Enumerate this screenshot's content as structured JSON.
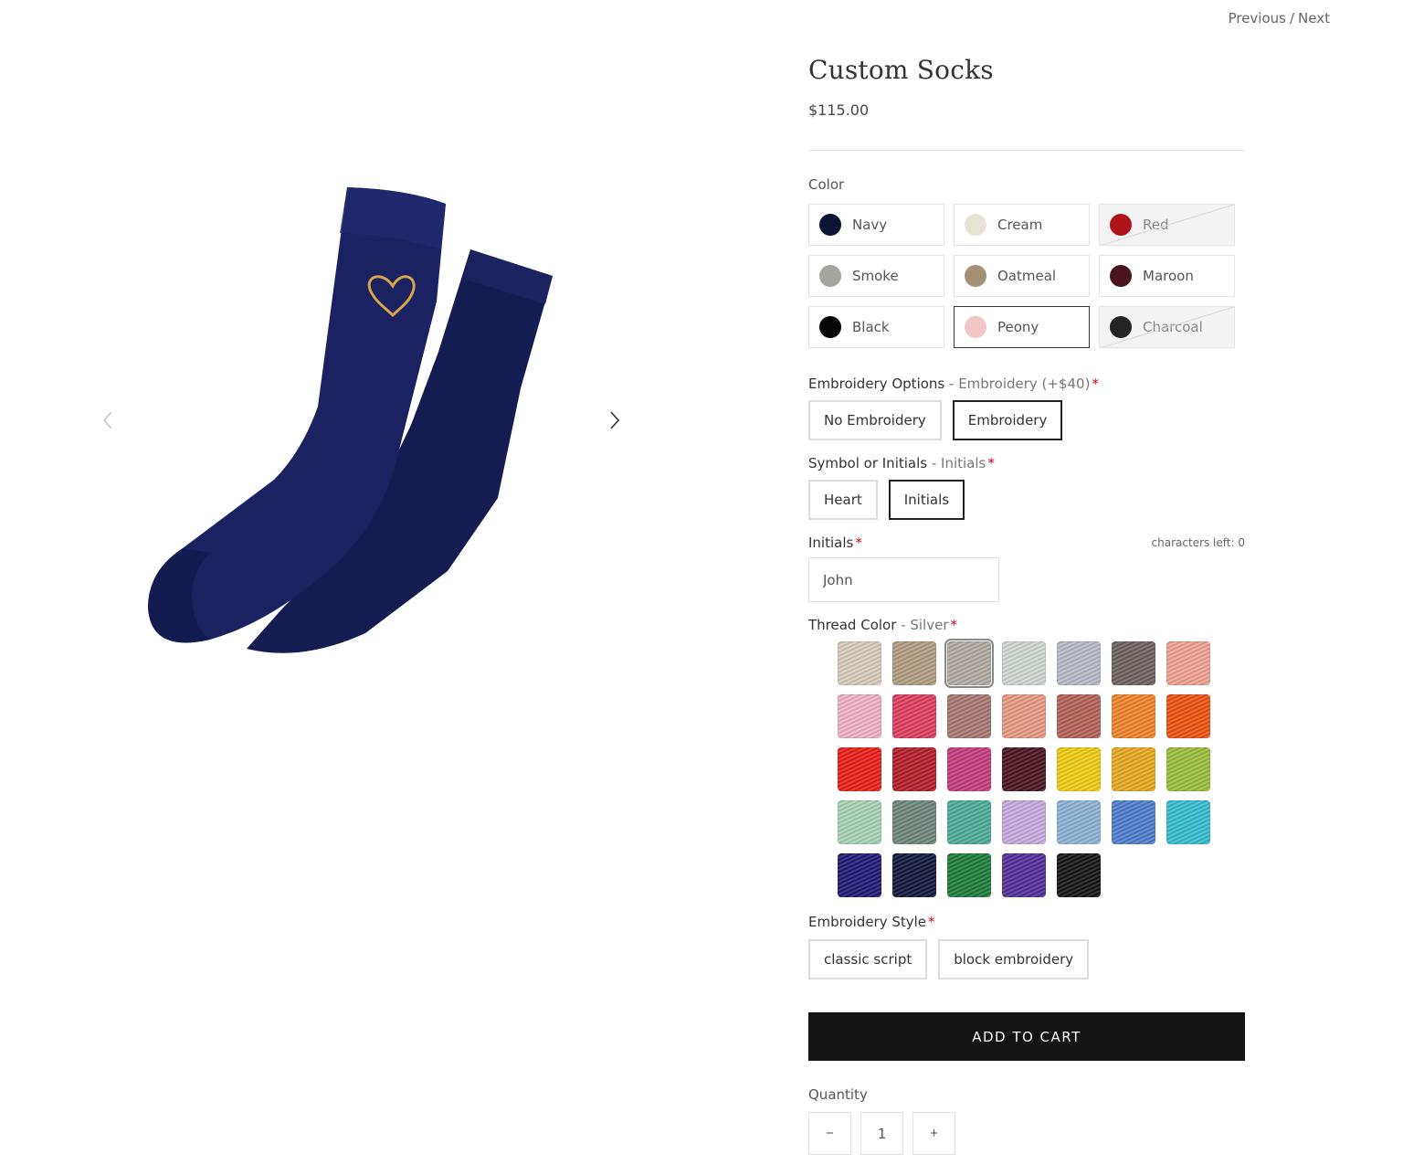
{
  "pager": {
    "previous": "Previous",
    "separator": "/",
    "next": "Next"
  },
  "product": {
    "title": "Custom Socks",
    "price": "$115.00"
  },
  "color": {
    "label": "Color",
    "options": [
      {
        "name": "Navy",
        "hex": "#0c1333",
        "state": "available"
      },
      {
        "name": "Cream",
        "hex": "#e8e3d3",
        "state": "available"
      },
      {
        "name": "Red",
        "hex": "#b0141b",
        "state": "soldout"
      },
      {
        "name": "Smoke",
        "hex": "#a6a49f",
        "state": "available"
      },
      {
        "name": "Oatmeal",
        "hex": "#a48f77",
        "state": "available"
      },
      {
        "name": "Maroon",
        "hex": "#4a141f",
        "state": "available"
      },
      {
        "name": "Black",
        "hex": "#070707",
        "state": "available"
      },
      {
        "name": "Peony",
        "hex": "#f2c6c2",
        "state": "selected"
      },
      {
        "name": "Charcoal",
        "hex": "#242424",
        "state": "soldout"
      }
    ]
  },
  "embroidery": {
    "label": "Embroidery Options",
    "selected_text": "- Embroidery (+$40)",
    "required_mark": "*",
    "options": [
      "No Embroidery",
      "Embroidery"
    ]
  },
  "symbol": {
    "label": "Symbol or Initials",
    "selected_text": "- Initials",
    "required_mark": "*",
    "options": [
      "Heart",
      "Initials"
    ]
  },
  "initials": {
    "label": "Initials",
    "required_mark": "*",
    "chars_left": "characters left: 0",
    "value": "John"
  },
  "thread": {
    "label": "Thread Color",
    "selected_text": "- Silver",
    "required_mark": "*",
    "colors": [
      "#d7cdbd",
      "#b39d82",
      "#b3aca6",
      "#d1d9d3",
      "#b8bcc6",
      "#6e625f",
      "#f2a293",
      "#f0b2c7",
      "#df3e60",
      "#a87872",
      "#e99c86",
      "#b56358",
      "#f4852b",
      "#ef5311",
      "#ea1f17",
      "#b51c2a",
      "#c53c7e",
      "#4b1521",
      "#f2cd14",
      "#ebaa21",
      "#9cbe3d",
      "#a9d3b9",
      "#6e877c",
      "#4dae98",
      "#c6ace0",
      "#8db5d6",
      "#4f7fcf",
      "#37bdd1",
      "#1f1a76",
      "#12173d",
      "#1e7e3a",
      "#50309a",
      "#151515"
    ],
    "selected_index": 2
  },
  "style": {
    "label": "Embroidery Style",
    "required_mark": "*",
    "options": [
      "classic script",
      "block embroidery"
    ]
  },
  "cart": {
    "label": "ADD TO CART"
  },
  "quantity": {
    "label": "Quantity",
    "value": "1",
    "minus": "−",
    "plus": "+"
  },
  "icons": {
    "prev": "chevron-left-icon",
    "next": "chevron-right-icon",
    "heart": "heart-embroidery-icon"
  }
}
